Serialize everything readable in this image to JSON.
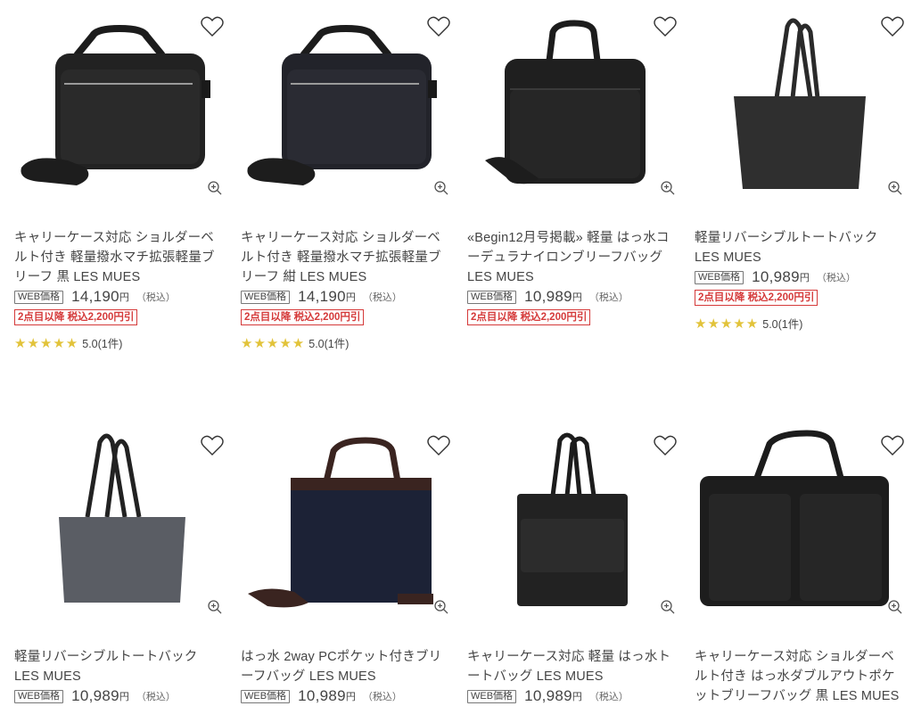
{
  "labels": {
    "web_price": "WEB価格",
    "tax": "（税込）",
    "yen": "円"
  },
  "colors": {
    "promo": "#d53a3a",
    "star": "#e2c33a"
  },
  "products": [
    {
      "title": "キャリーケース対応 ショルダーベルト付き 軽量撥水マチ拡張軽量ブリーフ 黒 LES MUES",
      "price": "14,190",
      "promo": "2点目以降 税込2,200円引",
      "stars": "★★★★★",
      "rating": "5.0(1件)"
    },
    {
      "title": "キャリーケース対応 ショルダーベルト付き 軽量撥水マチ拡張軽量ブリーフ 紺 LES MUES",
      "price": "14,190",
      "promo": "2点目以降 税込2,200円引",
      "stars": "★★★★★",
      "rating": "5.0(1件)"
    },
    {
      "title": "«Begin12月号掲載» 軽量 はっ水コーデュラナイロンブリーフバッグ LES MUES",
      "price": "10,989",
      "promo": "2点目以降 税込2,200円引"
    },
    {
      "title": "軽量リバーシブルトートバック LES MUES",
      "price": "10,989",
      "promo": "2点目以降 税込2,200円引",
      "stars": "★★★★★",
      "rating": "5.0(1件)"
    },
    {
      "title": "軽量リバーシブルトートバック LES MUES",
      "price": "10,989"
    },
    {
      "title": "はっ水 2way PCポケット付きブリーフバッグ LES MUES",
      "price": "10,989"
    },
    {
      "title": "キャリーケース対応 軽量 はっ水トートバッグ LES MUES",
      "price": "10,989"
    },
    {
      "title": "キャリーケース対応 ショルダーベルト付き はっ水ダブルアウトポケットブリーフバッグ 黒 LES MUES"
    }
  ]
}
